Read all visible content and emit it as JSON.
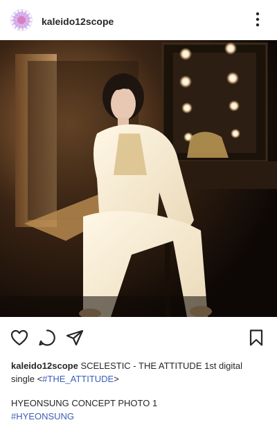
{
  "post": {
    "username": "kaleido12scope",
    "caption_username": "kaleido12scope",
    "caption_text": "SCELESTIC - THE ATTITUDE 1st digital single <",
    "caption_tag": "#THE_ATTITUDE",
    "caption_close": ">",
    "body_line": "HYEONSUNG CONCEPT PHOTO 1",
    "hashtag": "#HYEONSUNG"
  },
  "icons": {
    "more": "more-vertical-icon",
    "like": "heart-icon",
    "comment": "comment-icon",
    "share": "send-icon",
    "save": "bookmark-icon"
  },
  "colors": {
    "hashtag": "#3b5eb8",
    "text": "#262626"
  }
}
